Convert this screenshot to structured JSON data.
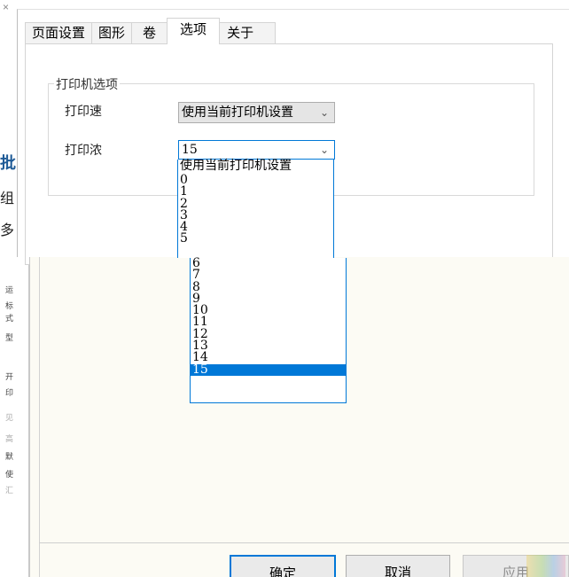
{
  "background": {
    "close_glyph": "×",
    "side_letters": [
      "批",
      "组",
      "多"
    ],
    "strip_glyphs": [
      "运",
      "标",
      "式",
      "型",
      "开",
      "印",
      "见",
      "高",
      "默",
      "使",
      "汇"
    ]
  },
  "tabs": [
    {
      "label": "页面设置",
      "active": false
    },
    {
      "label": "图形",
      "active": false
    },
    {
      "label": "卷",
      "active": false
    },
    {
      "label": "选项",
      "active": true
    },
    {
      "label": "关于",
      "active": false
    }
  ],
  "printer_options": {
    "group_title": "打印机选项",
    "speed_label": "打印速",
    "speed_value": "使用当前打印机设置",
    "density_label": "打印浓",
    "density_value": "15"
  },
  "density_options": [
    "使用当前打印机设置",
    "0",
    "1",
    "2",
    "3",
    "4",
    "5",
    "6",
    "7",
    "8",
    "9",
    "10",
    "11",
    "12",
    "13",
    "14",
    "15"
  ],
  "density_selected_index": 16,
  "buttons": {
    "ok": "确定",
    "cancel": "取消",
    "apply": "应用"
  },
  "colors": {
    "accent": "#0078d7",
    "dialog_body": "#fcfbf4"
  }
}
